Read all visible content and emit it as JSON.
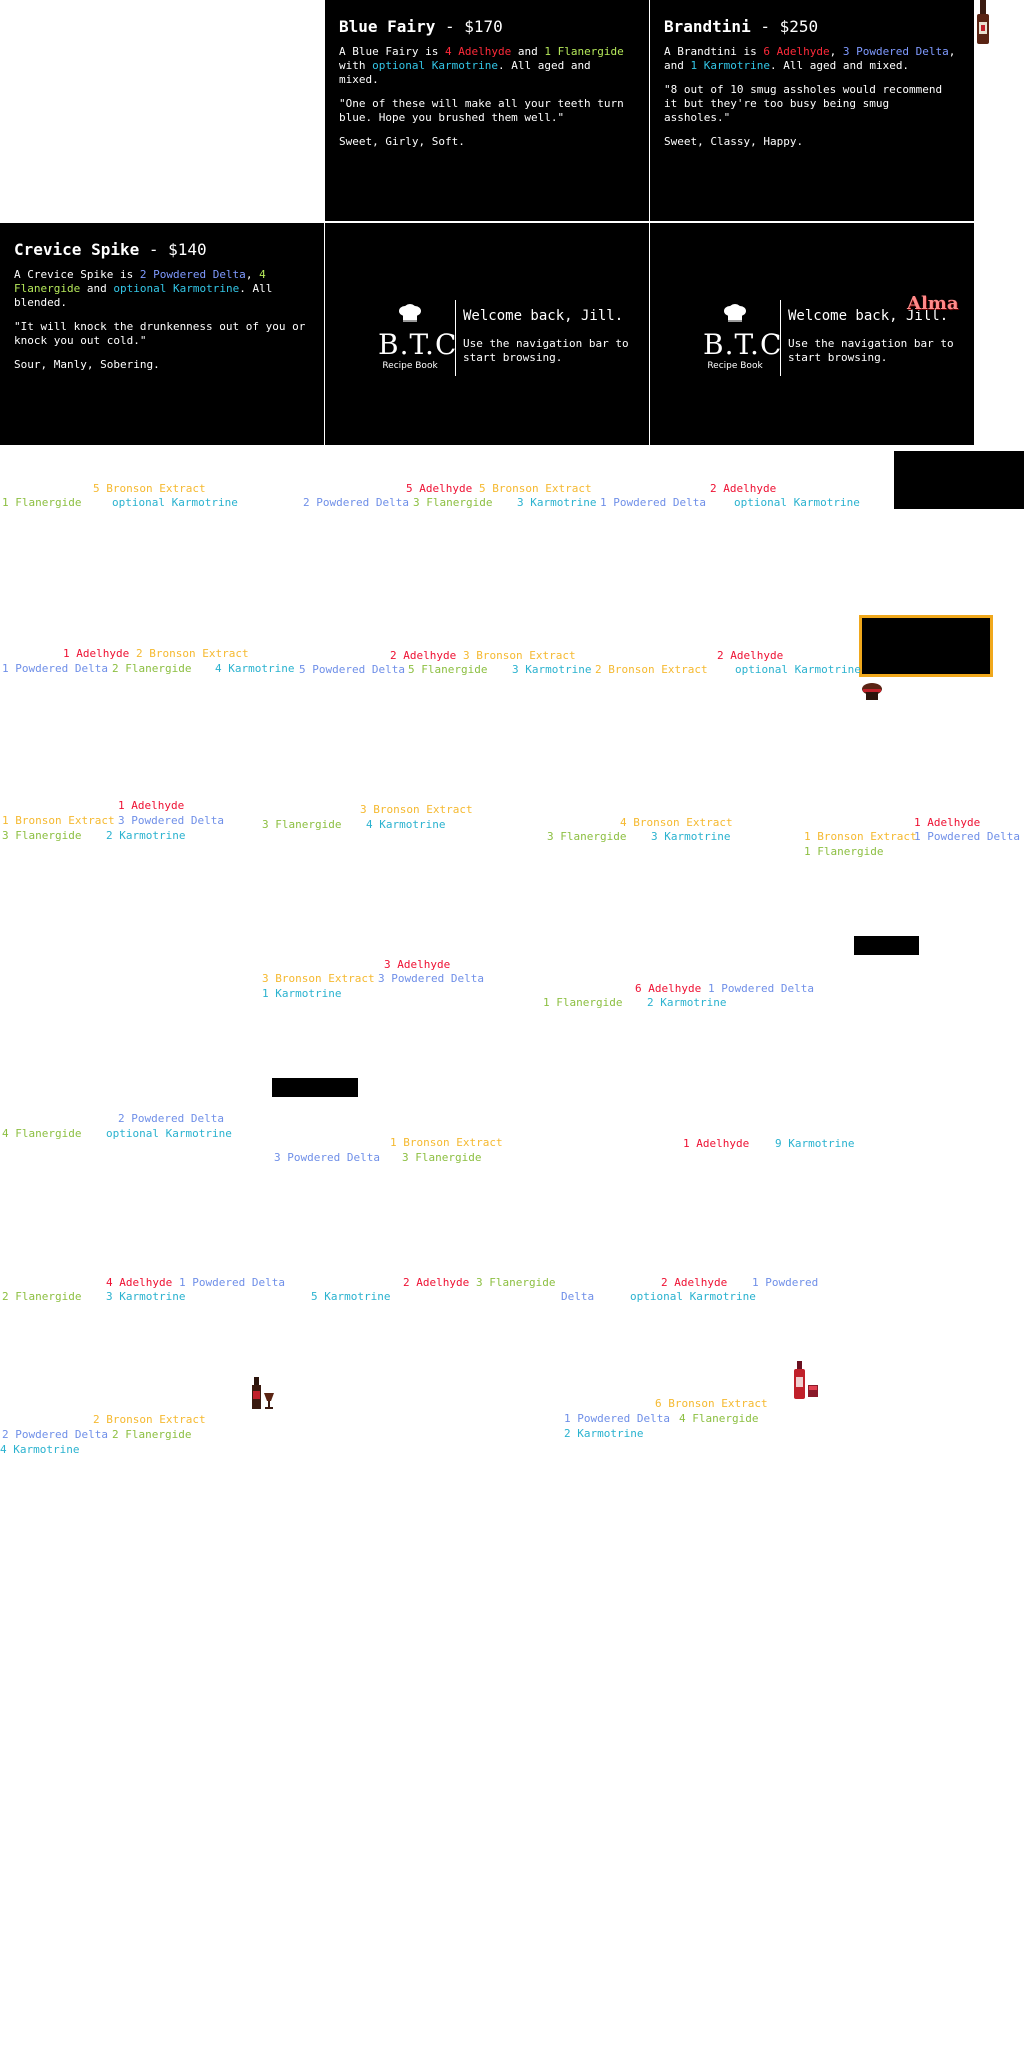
{
  "cards": {
    "blue_fairy": {
      "name": "Blue Fairy",
      "price": "$170",
      "recipe_parts": [
        "A Blue Fairy is ",
        "4 Adelhyde",
        " and ",
        "1 Flanergide",
        " with ",
        "optional Karmotrine",
        ". All aged and mixed."
      ],
      "quote": "\"One of these will make all your teeth turn blue. Hope you brushed them well.\"",
      "flavor": "Sweet, Girly, Soft."
    },
    "brandtini": {
      "name": "Brandtini",
      "price": "$250",
      "recipe_parts": [
        "A Brandtini is ",
        "6 Adelhyde",
        ", ",
        "3 Powdered Delta",
        ", and ",
        "1 Karmotrine",
        ". All aged and mixed."
      ],
      "quote": "\"8 out of 10 smug assholes would recommend it but they're too busy being smug assholes.\"",
      "flavor": "Sweet, Classy, Happy."
    },
    "crevice_spike": {
      "name": "Crevice Spike",
      "price": "$140",
      "recipe_parts": [
        "A Crevice Spike is ",
        "2 Powdered Delta",
        ", ",
        "4 Flanergide",
        " and ",
        "optional Karmotrine",
        ". All blended."
      ],
      "quote": "\"It will knock the drunkenness out of you or knock you out cold.\"",
      "flavor": "Sour, Manly, Sobering."
    }
  },
  "title_separator": "-",
  "welcome": {
    "logo_main": "B.T.C",
    "logo_sub": "Recipe Book",
    "title": "Welcome back, Jill.",
    "body": "Use the navigation bar to start browsing.",
    "overlay_name": "Alma"
  },
  "ingredient_labels": [
    {
      "text": "5 Bronson Extract",
      "kind": "bro"
    },
    {
      "text": "1 Flanergide",
      "kind": "fla"
    },
    {
      "text": "optional Karmotrine",
      "kind": "kar"
    },
    {
      "text": "5 Adelhyde",
      "kind": "ade"
    },
    {
      "text": "5 Bronson Extract",
      "kind": "bro"
    },
    {
      "text": "2 Powdered Delta",
      "kind": "pow"
    },
    {
      "text": "3 Flanergide",
      "kind": "fla"
    },
    {
      "text": "3 Karmotrine",
      "kind": "kar"
    },
    {
      "text": "1 Powdered Delta",
      "kind": "pow"
    },
    {
      "text": "2 Adelhyde",
      "kind": "ade"
    },
    {
      "text": "optional Karmotrine",
      "kind": "kar"
    },
    {
      "text": "1 Adelhyde",
      "kind": "ade"
    },
    {
      "text": "2 Bronson Extract",
      "kind": "bro"
    },
    {
      "text": "1 Powdered Delta",
      "kind": "pow"
    },
    {
      "text": "2 Flanergide",
      "kind": "fla"
    },
    {
      "text": "4 Karmotrine",
      "kind": "kar"
    },
    {
      "text": "5 Powdered Delta",
      "kind": "pow"
    },
    {
      "text": "2 Adelhyde",
      "kind": "ade"
    },
    {
      "text": "3 Bronson Extract",
      "kind": "bro"
    },
    {
      "text": "5 Flanergide",
      "kind": "fla"
    },
    {
      "text": "3 Karmotrine",
      "kind": "kar"
    },
    {
      "text": "2 Bronson Extract",
      "kind": "bro"
    },
    {
      "text": "2 Adelhyde",
      "kind": "ade"
    },
    {
      "text": "optional Karmotrine",
      "kind": "kar"
    },
    {
      "text": "1 Adelhyde",
      "kind": "ade"
    },
    {
      "text": "1 Bronson Extract",
      "kind": "bro"
    },
    {
      "text": "3 Powdered Delta",
      "kind": "pow"
    },
    {
      "text": "3 Flanergide",
      "kind": "fla"
    },
    {
      "text": "2 Karmotrine",
      "kind": "kar"
    },
    {
      "text": "3 Bronson Extract",
      "kind": "bro"
    },
    {
      "text": "3 Flanergide",
      "kind": "fla"
    },
    {
      "text": "4 Karmotrine",
      "kind": "kar"
    },
    {
      "text": "4 Bronson Extract",
      "kind": "bro"
    },
    {
      "text": "3 Flanergide",
      "kind": "fla"
    },
    {
      "text": "3 Karmotrine",
      "kind": "kar"
    },
    {
      "text": "1 Adelhyde",
      "kind": "ade"
    },
    {
      "text": "1 Bronson Extract",
      "kind": "bro"
    },
    {
      "text": "1 Powdered Delta",
      "kind": "pow"
    },
    {
      "text": "1 Flanergide",
      "kind": "fla"
    },
    {
      "text": "3 Adelhyde",
      "kind": "ade"
    },
    {
      "text": "3 Bronson Extract",
      "kind": "bro"
    },
    {
      "text": "3 Powdered Delta",
      "kind": "pow"
    },
    {
      "text": "1 Karmotrine",
      "kind": "kar"
    },
    {
      "text": "6 Adelhyde",
      "kind": "ade"
    },
    {
      "text": "1 Powdered Delta",
      "kind": "pow"
    },
    {
      "text": "1 Flanergide",
      "kind": "fla"
    },
    {
      "text": "2 Karmotrine",
      "kind": "kar"
    },
    {
      "text": "2 Powdered Delta",
      "kind": "pow"
    },
    {
      "text": "4 Flanergide",
      "kind": "fla"
    },
    {
      "text": "optional Karmotrine",
      "kind": "kar"
    },
    {
      "text": "1 Bronson Extract",
      "kind": "bro"
    },
    {
      "text": "3 Powdered Delta",
      "kind": "pow"
    },
    {
      "text": "3 Flanergide",
      "kind": "fla"
    },
    {
      "text": "1 Adelhyde",
      "kind": "ade"
    },
    {
      "text": "9 Karmotrine",
      "kind": "kar"
    },
    {
      "text": "4 Adelhyde",
      "kind": "ade"
    },
    {
      "text": "1 Powdered Delta",
      "kind": "pow"
    },
    {
      "text": "2 Flanergide",
      "kind": "fla"
    },
    {
      "text": "3 Karmotrine",
      "kind": "kar"
    },
    {
      "text": "2 Adelhyde",
      "kind": "ade"
    },
    {
      "text": "3 Flanergide",
      "kind": "fla"
    },
    {
      "text": "5 Karmotrine",
      "kind": "kar"
    },
    {
      "text": "2 Adelhyde",
      "kind": "ade"
    },
    {
      "text": "1 Powdered",
      "kind": "pow"
    },
    {
      "text": "Delta",
      "kind": "pow"
    },
    {
      "text": "optional Karmotrine",
      "kind": "kar"
    },
    {
      "text": "2 Bronson Extract",
      "kind": "bro"
    },
    {
      "text": "2 Powdered Delta",
      "kind": "pow"
    },
    {
      "text": "2 Flanergide",
      "kind": "fla"
    },
    {
      "text": "4 Karmotrine",
      "kind": "kar"
    },
    {
      "text": "6 Bronson Extract",
      "kind": "bro"
    },
    {
      "text": "1 Powdered Delta",
      "kind": "pow"
    },
    {
      "text": "4 Flanergide",
      "kind": "fla"
    },
    {
      "text": "2 Karmotrine",
      "kind": "kar"
    }
  ],
  "colors": {
    "adelhyde": "#ee1133",
    "bronson_extract": "#f5b930",
    "powdered_delta": "#6f8fe8",
    "flanergide": "#8cbf41",
    "karmotrine": "#2ab2cf",
    "card_background": "#000000",
    "highlight_border": "#f0a81c"
  },
  "icons": [
    "bottle-icon",
    "chef-hat-icon",
    "bottle-and-glass-icon"
  ]
}
